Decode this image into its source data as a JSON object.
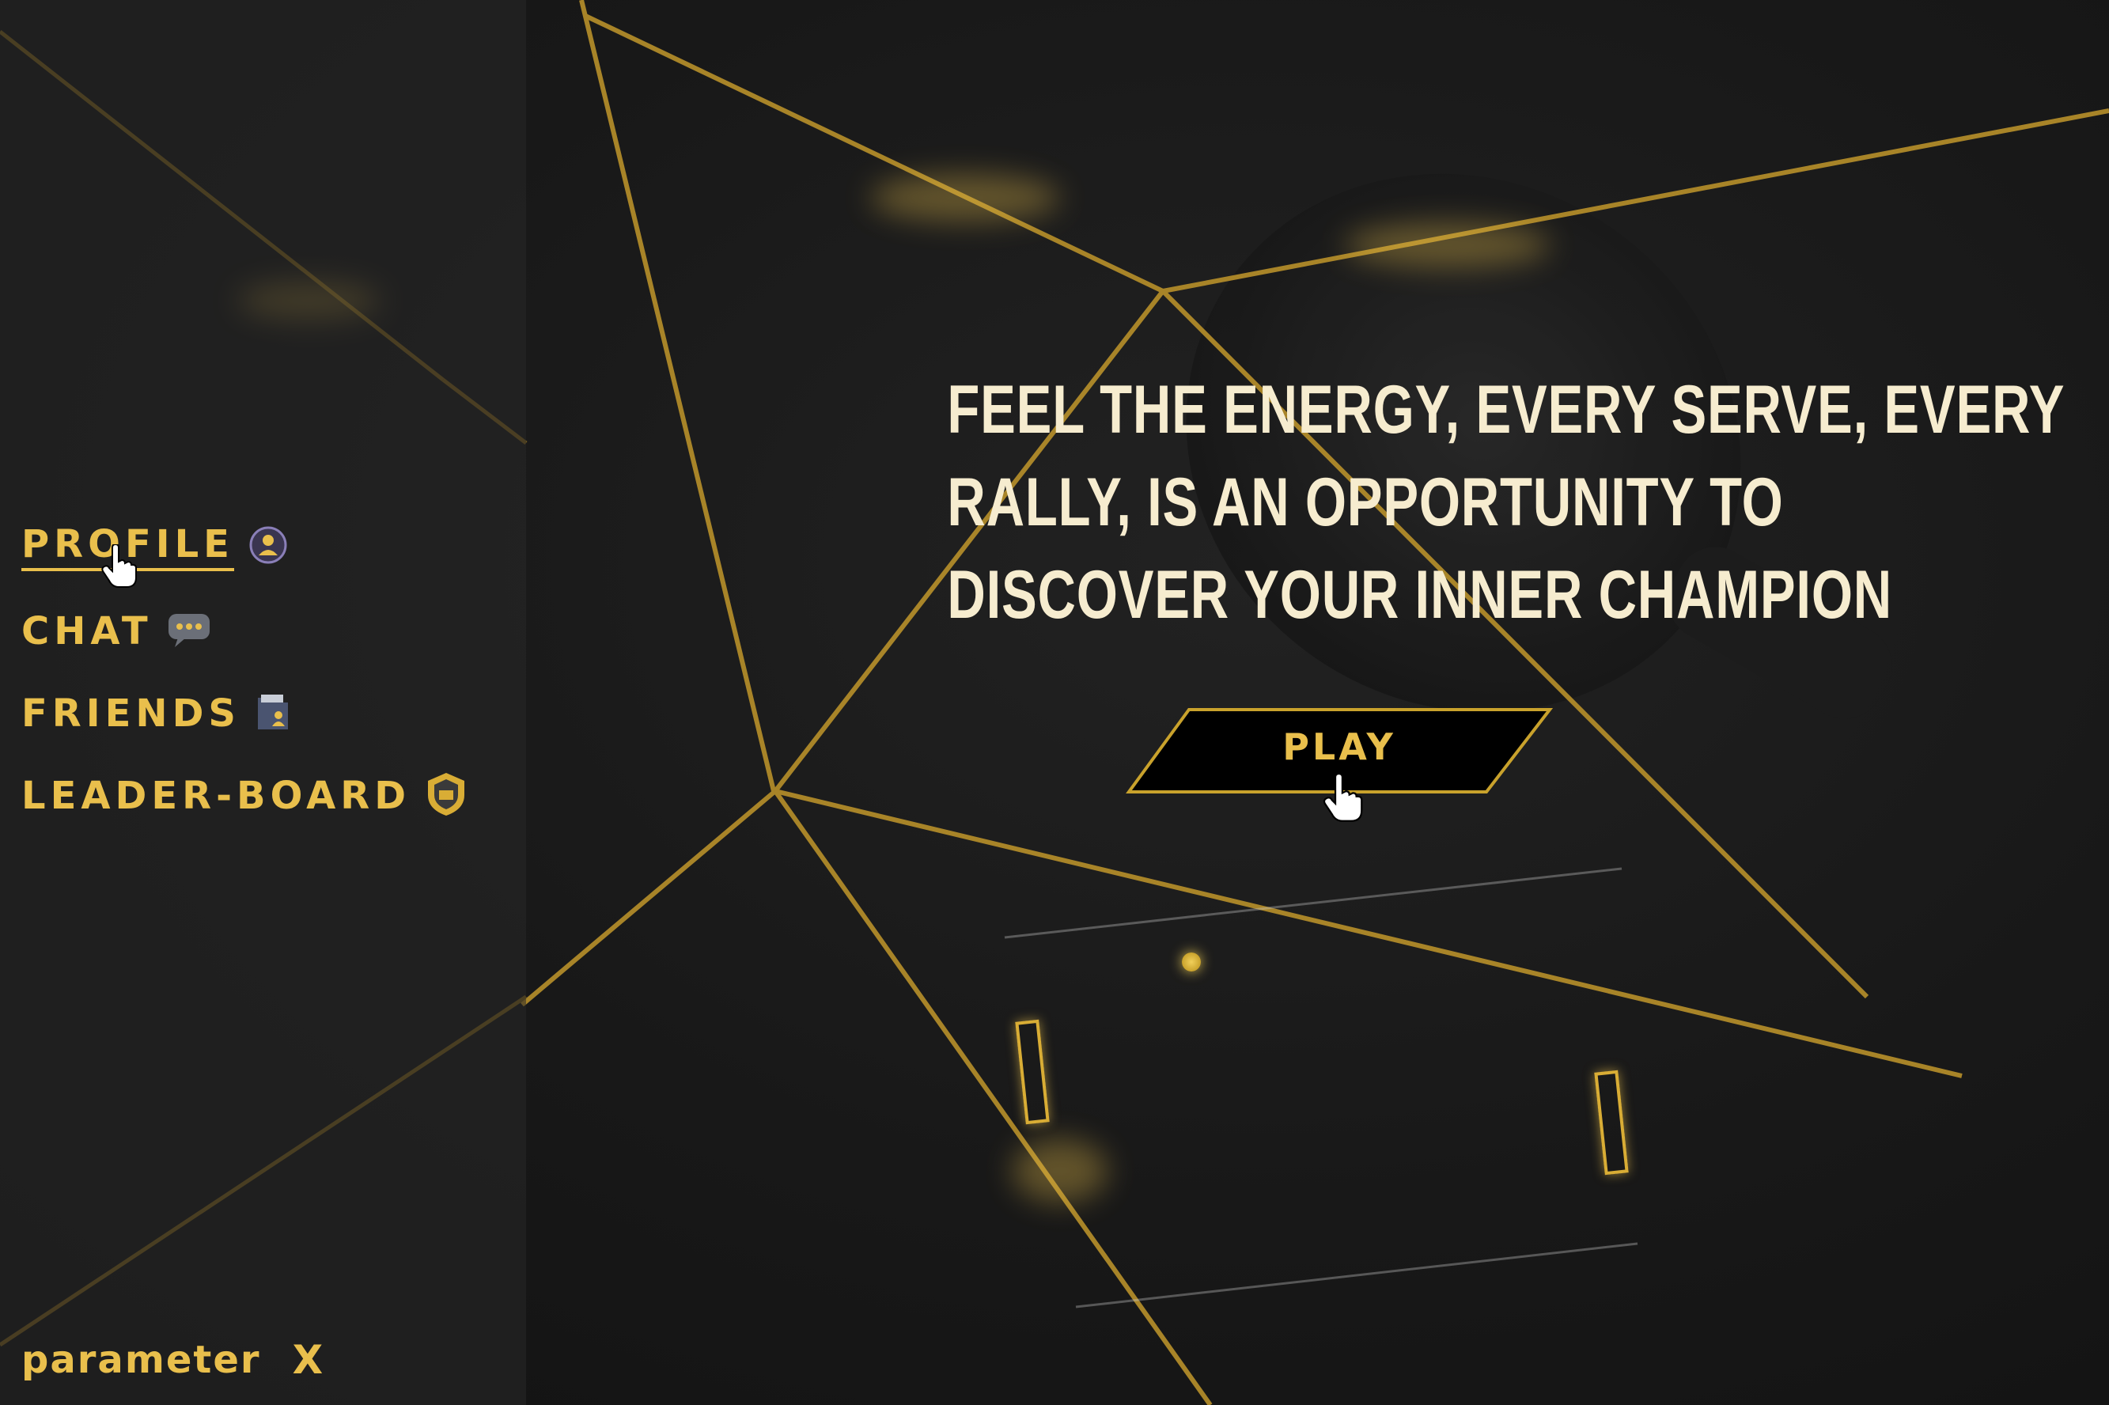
{
  "sidebar": {
    "items": [
      {
        "label": "PROFILE",
        "icon": "profile-icon",
        "active": true
      },
      {
        "label": "CHAT",
        "icon": "chat-bubble-icon",
        "active": false
      },
      {
        "label": "FRIENDS",
        "icon": "friends-folder-icon",
        "active": false
      },
      {
        "label": "LEADER-BOARD",
        "icon": "leaderboard-shield-icon",
        "active": false
      }
    ],
    "footer": {
      "label": "parameter",
      "close_label": "X"
    }
  },
  "hero": {
    "tagline_lines": [
      "FEEL THE ENERGY, EVERY SERVE, EVERY",
      "RALLY, IS AN OPPORTUNITY TO",
      "DISCOVER YOUR INNER CHAMPION"
    ],
    "play_label": "PLAY"
  },
  "colors": {
    "accent": "#e9bf4c",
    "tagline": "#f6eccf",
    "background": "#151515"
  }
}
